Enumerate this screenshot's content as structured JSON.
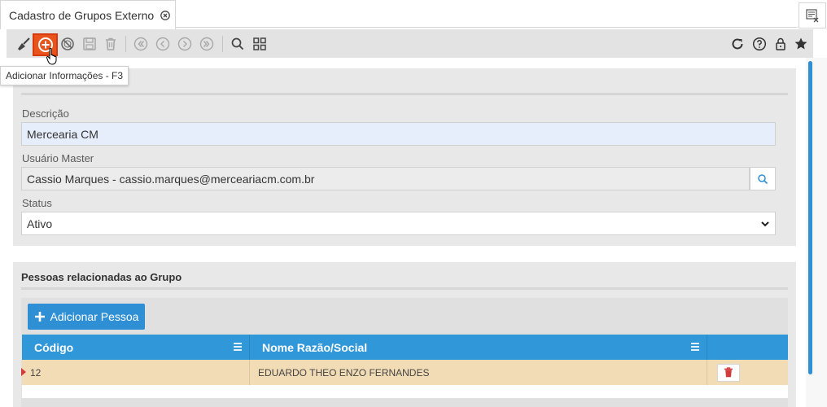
{
  "tab": {
    "title": "Cadastro de Grupos Externo"
  },
  "toolbar": {
    "tooltip": "Adicionar Informações - F3"
  },
  "form": {
    "descricao": {
      "label": "Descrição",
      "value": "Mercearia CM"
    },
    "usuario_master": {
      "label": "Usuário Master",
      "value": "Cassio Marques - cassio.marques@merceariacm.com.br"
    },
    "status": {
      "label": "Status",
      "value": "Ativo"
    }
  },
  "pessoas": {
    "title": "Pessoas relacionadas ao Grupo",
    "add_button": "Adicionar Pessoa",
    "columns": [
      "Código",
      "Nome Razão/Social"
    ],
    "rows": [
      {
        "codigo": "12",
        "nome": "EDUARDO THEO ENZO FERNANDES"
      }
    ]
  },
  "colors": {
    "accent": "#2e8fd4",
    "header": "#3097d8",
    "highlight_row": "#f2dcb5",
    "add_button_active": "#e8541c"
  }
}
